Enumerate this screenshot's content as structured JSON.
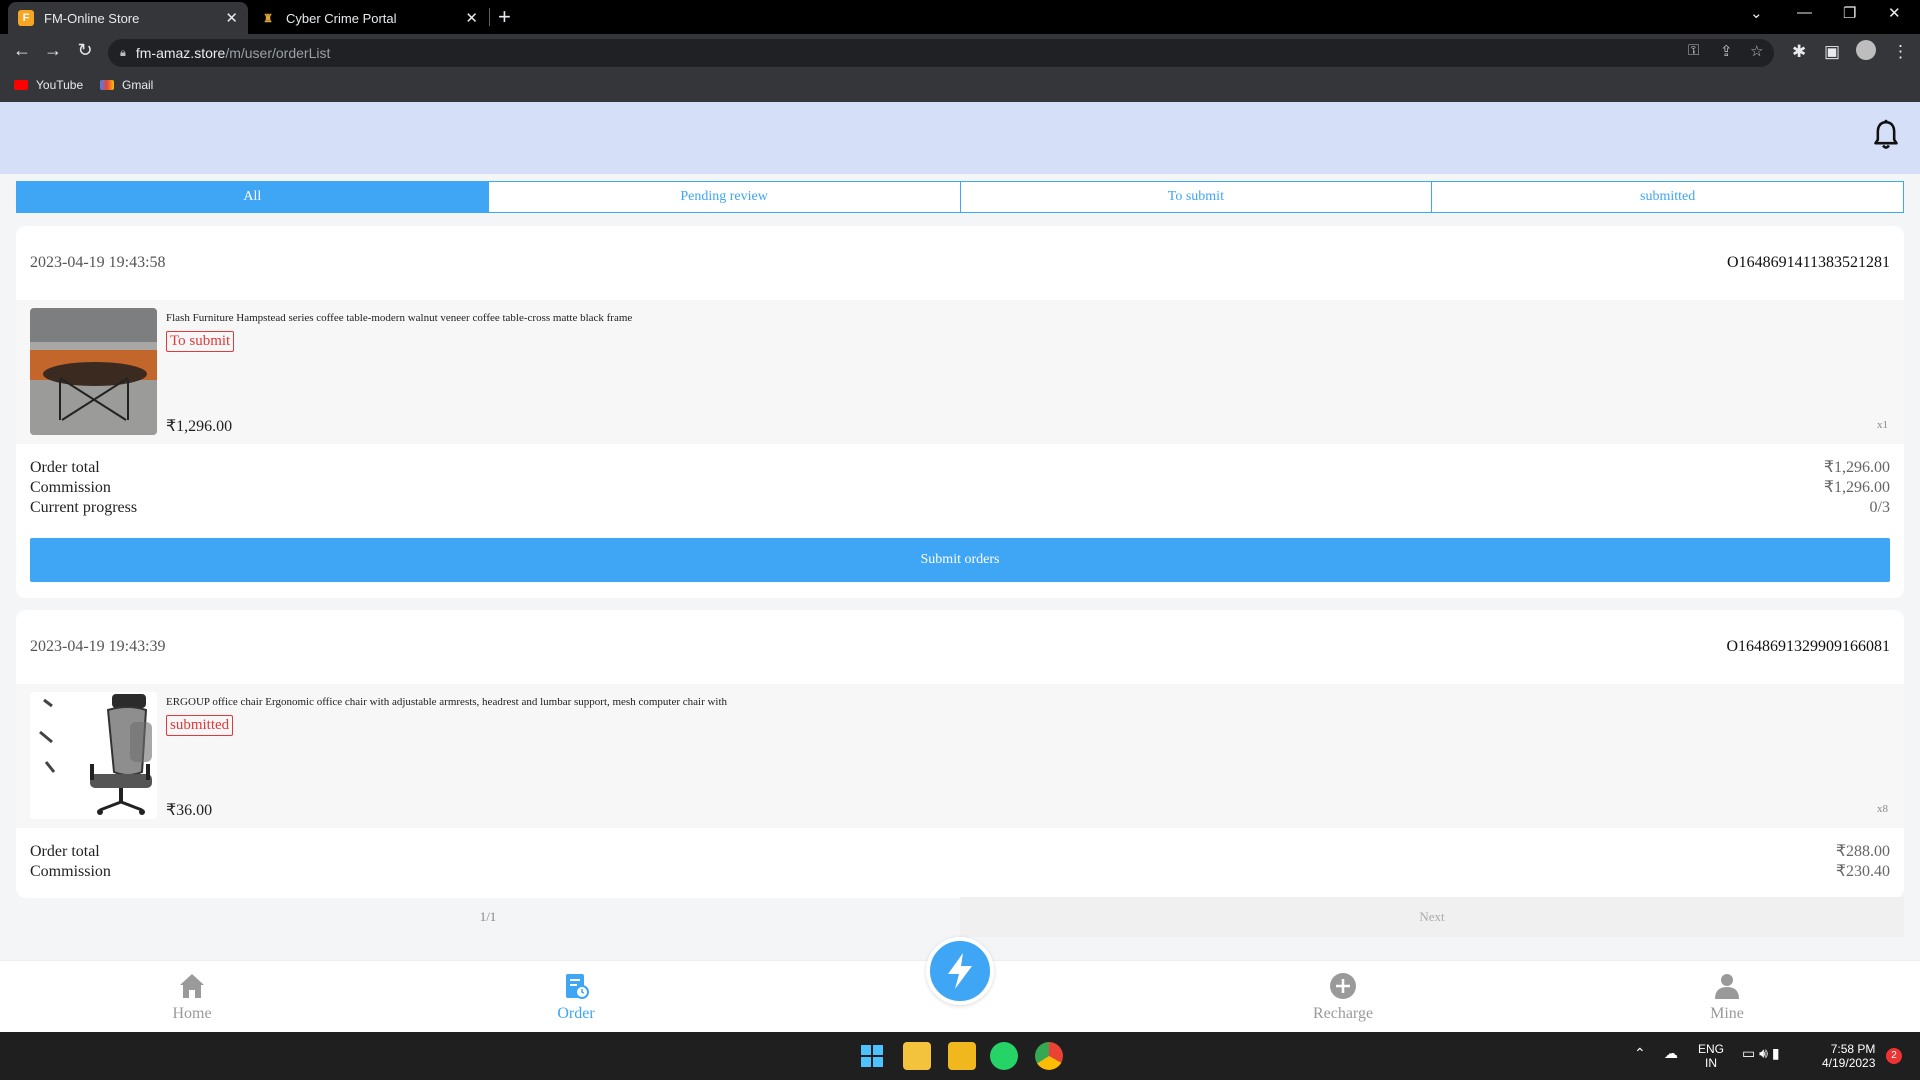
{
  "browser": {
    "tabs": [
      {
        "title": "FM-Online Store",
        "active": true
      },
      {
        "title": "Cyber Crime Portal",
        "active": false
      }
    ],
    "url_host": "fm-amaz.store",
    "url_path": "/m/user/orderList",
    "bookmarks": [
      "YouTube",
      "Gmail"
    ]
  },
  "filter_tabs": [
    "All",
    "Pending review",
    "To submit",
    "submitted"
  ],
  "orders": [
    {
      "date": "2023-04-19 19:43:58",
      "order_id": "O1648691411383521281",
      "product_title": "Flash Furniture Hampstead series coffee table-modern walnut veneer coffee table-cross matte black frame",
      "status": "To submit",
      "price": "₹1,296.00",
      "qty": "x1",
      "order_total_label": "Order total",
      "order_total": "₹1,296.00",
      "commission_label": "Commission",
      "commission": "₹1,296.00",
      "progress_label": "Current progress",
      "progress": "0/3",
      "submit_label": "Submit orders"
    },
    {
      "date": "2023-04-19 19:43:39",
      "order_id": "O1648691329909166081",
      "product_title": "ERGOUP office chair Ergonomic office chair with adjustable armrests, headrest and lumbar support, mesh computer chair with",
      "status": "submitted",
      "price": "₹36.00",
      "qty": "x8",
      "order_total_label": "Order total",
      "order_total": "₹288.00",
      "commission_label": "Commission",
      "commission": "₹230.40"
    }
  ],
  "pager": {
    "page": "1/1",
    "next": "Next"
  },
  "bottom_nav": [
    "Home",
    "Order",
    "Recharge",
    "Mine"
  ],
  "taskbar": {
    "lang": "ENG",
    "region": "IN",
    "time": "7:58 PM",
    "date": "4/19/2023",
    "notifications": "2"
  },
  "colors": {
    "accent": "#3fa5f5",
    "header_bg": "#d5e0f8",
    "status_red": "#e03a3a"
  }
}
